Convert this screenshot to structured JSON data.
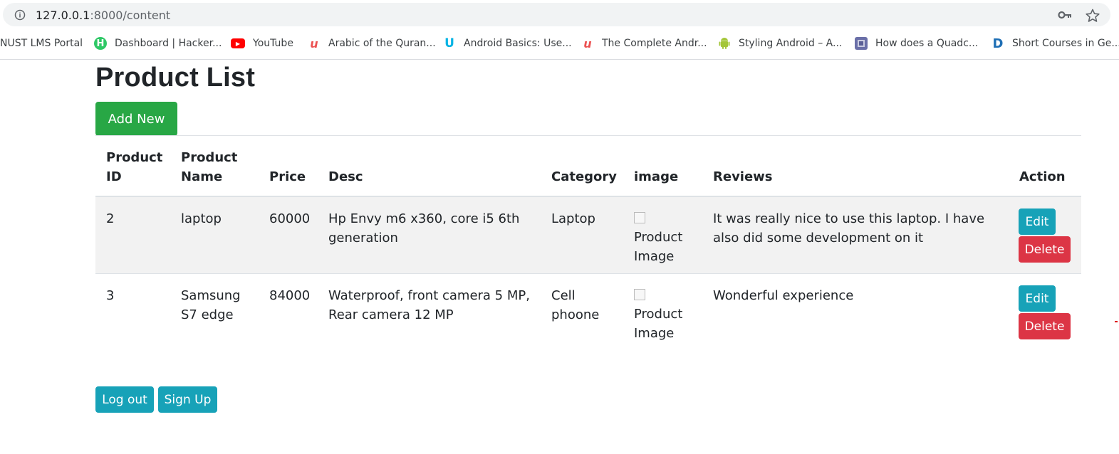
{
  "browser": {
    "url_host": "127.0.0.1",
    "url_rest": ":8000/content",
    "info_icon": "info-icon",
    "key_icon": "key-icon",
    "star_icon": "star-icon"
  },
  "bookmarks": [
    {
      "label": "NUST LMS Portal"
    },
    {
      "label": "Dashboard | Hacker..."
    },
    {
      "label": "YouTube"
    },
    {
      "label": "Arabic of the Quran..."
    },
    {
      "label": "Android Basics: Use..."
    },
    {
      "label": "The Complete Andr..."
    },
    {
      "label": "Styling Android – A..."
    },
    {
      "label": "How does a Quadc..."
    },
    {
      "label": "Short Courses in Ge..."
    }
  ],
  "page": {
    "title": "Product List",
    "add_new_label": "Add New",
    "logout_label": "Log out",
    "signup_label": "Sign Up"
  },
  "table": {
    "headers": {
      "id_line1": "Product",
      "id_line2": "ID",
      "name_line1": "Product",
      "name_line2": "Name",
      "price": "Price",
      "desc": "Desc",
      "category": "Category",
      "image": "image",
      "reviews": "Reviews",
      "action": "Action"
    },
    "rows": [
      {
        "id": "2",
        "name_line1": "laptop",
        "name_line2": "",
        "price": "60000",
        "desc_line1": "Hp Envy m6 x360, core i5 6th",
        "desc_line2": "generation",
        "category_line1": "Laptop",
        "category_line2": "",
        "image_alt_line1": "Product",
        "image_alt_line2": "Image",
        "reviews_line1": "It was really nice to use this laptop. I have",
        "reviews_line2": "also did some development on it",
        "edit_label": "Edit",
        "delete_label": "Delete"
      },
      {
        "id": "3",
        "name_line1": "Samsung",
        "name_line2": "S7 edge",
        "price": "84000",
        "desc_line1": "Waterproof, front camera 5 MP,",
        "desc_line2": "Rear camera 12 MP",
        "category_line1": "Cell",
        "category_line2": "phoone",
        "image_alt_line1": "Product",
        "image_alt_line2": "Image",
        "reviews_line1": "Wonderful experience",
        "reviews_line2": "",
        "edit_label": "Edit",
        "delete_label": "Delete"
      }
    ]
  },
  "colors": {
    "success": "#28a745",
    "info": "#17a2b8",
    "danger": "#dc3545",
    "stripe": "#f2f2f2"
  }
}
